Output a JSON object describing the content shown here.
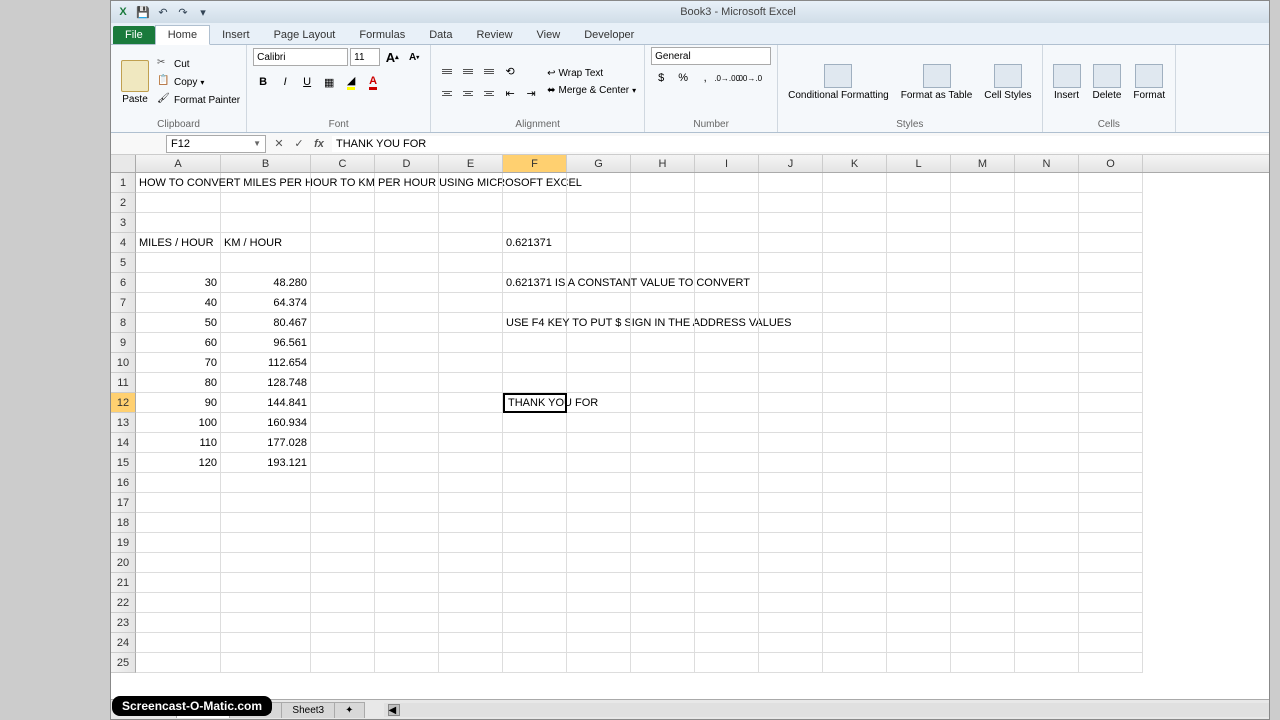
{
  "window": {
    "title": "Book3 - Microsoft Excel"
  },
  "qat": {
    "save": "💾",
    "undo": "↶",
    "redo": "↷"
  },
  "tabs": {
    "file": "File",
    "home": "Home",
    "insert": "Insert",
    "page_layout": "Page Layout",
    "formulas": "Formulas",
    "data": "Data",
    "review": "Review",
    "view": "View",
    "developer": "Developer"
  },
  "ribbon": {
    "clipboard": {
      "label": "Clipboard",
      "paste": "Paste",
      "cut": "Cut",
      "copy": "Copy",
      "painter": "Format Painter"
    },
    "font": {
      "label": "Font",
      "name": "Calibri",
      "size": "11",
      "grow": "A",
      "shrink": "A"
    },
    "alignment": {
      "label": "Alignment",
      "wrap": "Wrap Text",
      "merge": "Merge & Center"
    },
    "number": {
      "label": "Number",
      "format": "General",
      "currency": "$",
      "percent": "%",
      "comma": ","
    },
    "styles": {
      "label": "Styles",
      "cond": "Conditional Formatting",
      "table": "Format as Table",
      "cell": "Cell Styles"
    },
    "cells": {
      "label": "Cells",
      "insert": "Insert",
      "delete": "Delete",
      "format": "Format"
    }
  },
  "namebox": "F12",
  "formula_bar": "THANK YOU FOR",
  "columns": [
    "A",
    "B",
    "C",
    "D",
    "E",
    "F",
    "G",
    "H",
    "I",
    "J",
    "K",
    "L",
    "M",
    "N",
    "O"
  ],
  "selected_col": "F",
  "selected_row": 12,
  "cells": {
    "A1": "HOW TO CONVERT MILES PER HOUR TO KM PER HOUR USING MICROSOFT EXCEL",
    "A4": "MILES / HOUR",
    "B4": "KM / HOUR",
    "A6": "30",
    "B6": "48.280",
    "A7": "40",
    "B7": "64.374",
    "A8": "50",
    "B8": "80.467",
    "A9": "60",
    "B9": "96.561",
    "A10": "70",
    "B10": "112.654",
    "A11": "80",
    "B11": "128.748",
    "A12": "90",
    "B12": "144.841",
    "A13": "100",
    "B13": "160.934",
    "A14": "110",
    "B14": "177.028",
    "A15": "120",
    "B15": "193.121",
    "F4": "0.621371",
    "F6": "0.621371 IS A CONSTANT VALUE TO CONVERT",
    "F8": "USE F4 KEY TO PUT $ SIGN IN THE ADDRESS VALUES",
    "F12": "THANK YOU FOR"
  },
  "sheets": {
    "s1": "Sheet1",
    "s2": "Sheet2",
    "s3": "Sheet3"
  },
  "watermark": "Screencast-O-Matic.com"
}
